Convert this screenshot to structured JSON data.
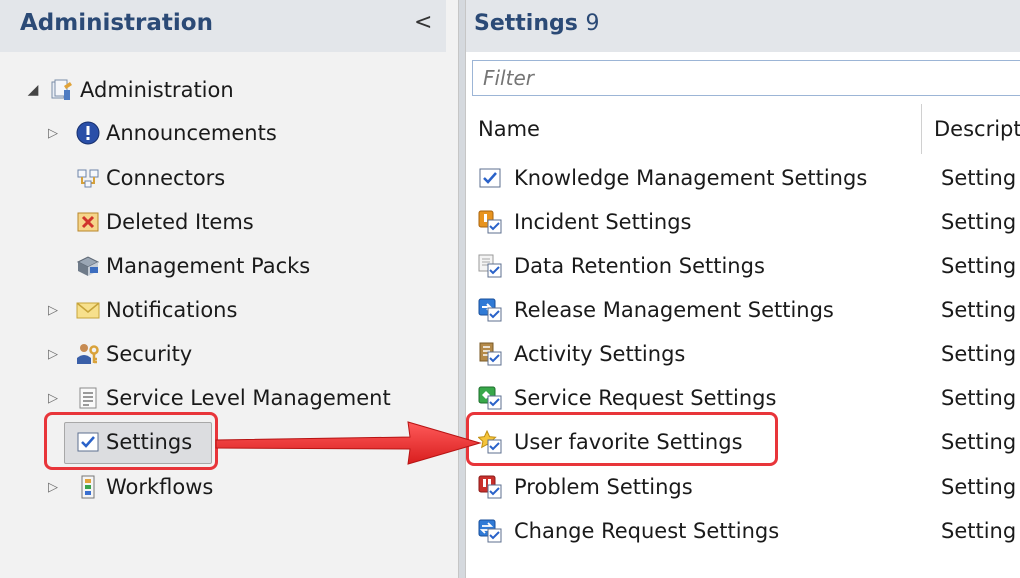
{
  "left_pane": {
    "title": "Administration",
    "collapse_glyph": "<",
    "tree": [
      {
        "label": "Administration",
        "icon": "admin-folder-icon",
        "expander": "open"
      },
      {
        "label": "Announcements",
        "icon": "info-icon",
        "expander": "closed"
      },
      {
        "label": "Connectors",
        "icon": "connectors-icon",
        "expander": "none"
      },
      {
        "label": "Deleted Items",
        "icon": "deleted-items-icon",
        "expander": "none"
      },
      {
        "label": "Management Packs",
        "icon": "management-packs-icon",
        "expander": "none"
      },
      {
        "label": "Notifications",
        "icon": "envelope-icon",
        "expander": "closed"
      },
      {
        "label": "Security",
        "icon": "users-key-icon",
        "expander": "closed"
      },
      {
        "label": "Service Level Management",
        "icon": "document-icon",
        "expander": "closed"
      },
      {
        "label": "Settings",
        "icon": "checkbox-icon",
        "expander": "none",
        "selected": true
      },
      {
        "label": "Workflows",
        "icon": "workflow-icon",
        "expander": "closed"
      }
    ]
  },
  "right_pane": {
    "title": "Settings",
    "count": "9",
    "filter_placeholder": "Filter",
    "columns": [
      "Name",
      "Descript"
    ],
    "rows": [
      {
        "name": "Knowledge Management Settings",
        "desc": "Setting",
        "icon": "knowledge-settings-icon"
      },
      {
        "name": "Incident Settings",
        "desc": "Setting",
        "icon": "incident-settings-icon"
      },
      {
        "name": "Data Retention Settings",
        "desc": "Setting",
        "icon": "data-retention-settings-icon"
      },
      {
        "name": "Release Management Settings",
        "desc": "Setting",
        "icon": "release-settings-icon"
      },
      {
        "name": "Activity Settings",
        "desc": "Setting",
        "icon": "activity-settings-icon"
      },
      {
        "name": "Service Request Settings",
        "desc": "Setting",
        "icon": "service-request-settings-icon"
      },
      {
        "name": "User favorite Settings",
        "desc": "Setting",
        "icon": "user-favorite-settings-icon",
        "highlighted": true
      },
      {
        "name": "Problem Settings",
        "desc": "Setting",
        "icon": "problem-settings-icon"
      },
      {
        "name": "Change Request Settings",
        "desc": "Setting",
        "icon": "change-request-settings-icon"
      }
    ]
  },
  "colors": {
    "header_text": "#2b4a76",
    "highlight": "#e8353a",
    "pane_bg": "#f2f2f2",
    "header_bg": "#e3e6ea"
  }
}
